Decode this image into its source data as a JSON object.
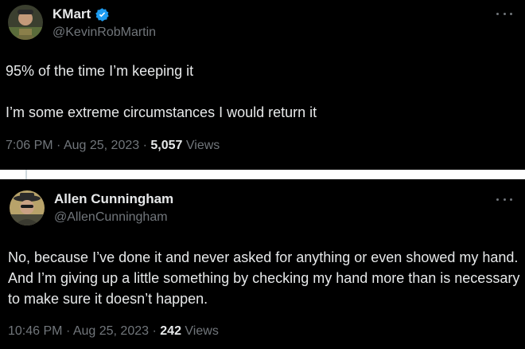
{
  "colors": {
    "background": "#000000",
    "text_primary": "#e7e9ea",
    "text_secondary": "#71767b",
    "verified_badge": "#1d9bf0",
    "separator": "#ffffff"
  },
  "tweets": [
    {
      "author": {
        "display_name": "KMart",
        "handle": "@KevinRobMartin",
        "verified": true,
        "avatar_icon": "profile-photo"
      },
      "paragraphs": [
        "95% of the time I’m keeping it",
        "I’m some extreme circumstances I would return it"
      ],
      "time": "7:06 PM",
      "date": "Aug 25, 2023",
      "views_count": "5,057",
      "views_label": "Views",
      "more_icon": "more-horizontal-icon"
    },
    {
      "author": {
        "display_name": "Allen Cunningham",
        "handle": "@AllenCunningham",
        "verified": false,
        "avatar_icon": "profile-photo"
      },
      "paragraphs": [
        "No, because I’ve done it and never asked for anything or even showed my hand.  And I’m giving up a little something by checking my hand more than is necessary to make sure it doesn’t happen."
      ],
      "time": "10:46 PM",
      "date": "Aug 25, 2023",
      "views_count": "242",
      "views_label": "Views",
      "more_icon": "more-horizontal-icon"
    }
  ],
  "separator_char": "·"
}
